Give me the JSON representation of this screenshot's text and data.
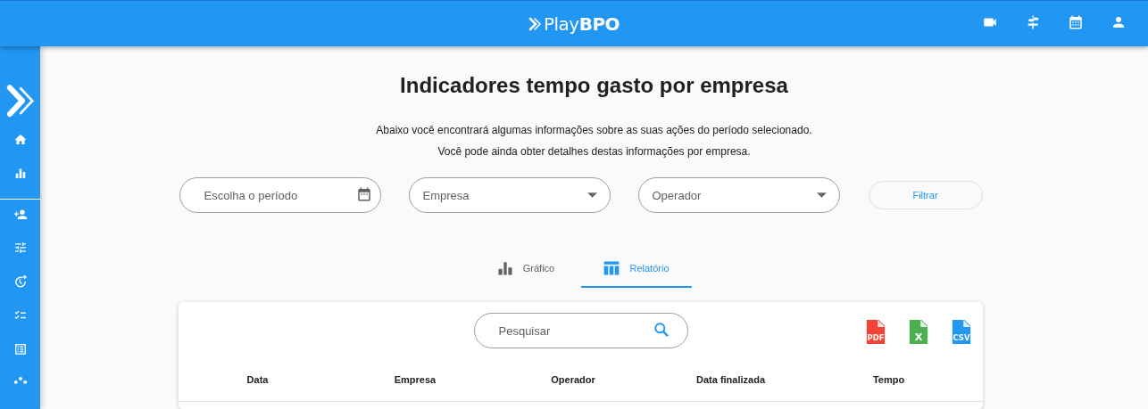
{
  "header": {
    "logo": "Play**BPO**"
  },
  "page": {
    "title": "Indicadores tempo gasto por empresa",
    "description": [
      "Abaixo você encontrará algumas informações sobre as suas ações do período selecionado.",
      "Você pode ainda obter detalhes destas informações por empresa."
    ]
  },
  "filters": {
    "period": {
      "placeholder": "Escolha o período"
    },
    "company": {
      "placeholder": "Empresa"
    },
    "operator": {
      "placeholder": "Operador"
    },
    "button": "Filtrar"
  },
  "tabs": [
    {
      "label": "Gráfico",
      "kind": "chart",
      "selected": false
    },
    {
      "label": "Relatório",
      "kind": "table",
      "selected": true
    }
  ],
  "report": {
    "search": {
      "placeholder": "Pesquisar"
    },
    "exports": [
      {
        "label": "PDF",
        "color": "#f44336"
      },
      {
        "label": "X",
        "color": "#4caf50"
      },
      {
        "label": "CSV",
        "color": "#2196f3"
      }
    ],
    "columns": [
      "Data",
      "Empresa",
      "Operador",
      "Data finalizada",
      "Tempo"
    ]
  }
}
